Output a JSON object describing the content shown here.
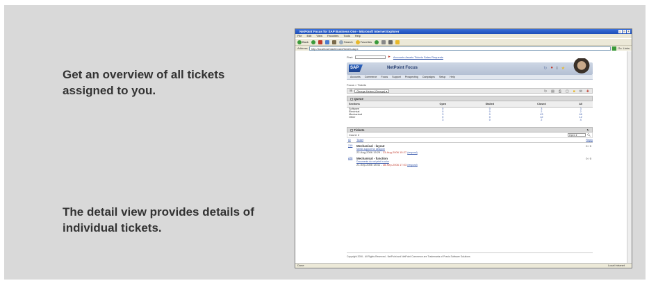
{
  "captions": {
    "overview": "Get an overview of all tickets assigned to you.",
    "detail": "The detail view provides details of individual tickets."
  },
  "browser": {
    "title": "NetPoint Focus for SAP Business One - Microsoft Internet Explorer",
    "menu": [
      "File",
      "Edit",
      "View",
      "Favorites",
      "Tools",
      "Help"
    ],
    "toolbar": {
      "back": "Back",
      "search": "Search",
      "favorites": "Favorites"
    },
    "address_label": "Address",
    "address_value": "http://localhost/dashboard/tickets.aspx",
    "go_label": "Go",
    "links_label": "Links",
    "status_left": "Done",
    "status_right": "Local intranet"
  },
  "app": {
    "find_label": "Find:",
    "find_links": "Accounts Assets Tickets Sales Requests",
    "logo": "SAP",
    "title": "NetPoint Focus",
    "nav": [
      "Accounts",
      "Commerce",
      "Focus",
      "Support",
      "Prospecting",
      "Campaigns",
      "Setup",
      "Help"
    ],
    "breadcrumb": "Focus > Tickets",
    "user_select": "George Heiser (George)",
    "queue": {
      "title": "Queue",
      "headers": [
        "Sections",
        "Open",
        "Stalled",
        "Closed",
        "All"
      ],
      "rows": [
        {
          "section": "Software",
          "open": "0",
          "stalled": "0",
          "closed": "3",
          "all": "3"
        },
        {
          "section": "Electrical",
          "open": "0",
          "stalled": "0",
          "closed": "2",
          "all": "2"
        },
        {
          "section": "Mechanical",
          "open": "3",
          "stalled": "0",
          "closed": "43",
          "all": "46"
        },
        {
          "section": "Other",
          "open": "0",
          "stalled": "0",
          "closed": "12",
          "all": "12"
        },
        {
          "section": "",
          "open": "3",
          "stalled": "0",
          "closed": "2",
          "all": "4"
        }
      ]
    },
    "tickets": {
      "title": "Tickets",
      "count_label": "Count: 2",
      "status_value": "Open",
      "headers": {
        "id": "ID",
        "ticket": "Ticket",
        "reply": "Reply"
      },
      "items": [
        {
          "id": "219",
          "title": "Mechanical - layout",
          "link": "Needs support for designer",
          "date_start": "22-Aug-2006 15:29 - ",
          "date_end": "23-Aug-2006 15:27",
          "action": "(respond)",
          "count": "0 / 0"
        },
        {
          "id": "228",
          "title": "Mechanical - function",
          "link": "Documents do not print in color",
          "date_start": "21-Sep-2006 18:41 - ",
          "date_end": "28-Sep-2006 17:03",
          "action": "(respond)",
          "count": "0 / 0"
        }
      ]
    },
    "footer": "Copyright 2006 - All Rights Reserved - NetPoint and NetPoint Commerce are Trademarks of Praxis Software Solutions"
  }
}
